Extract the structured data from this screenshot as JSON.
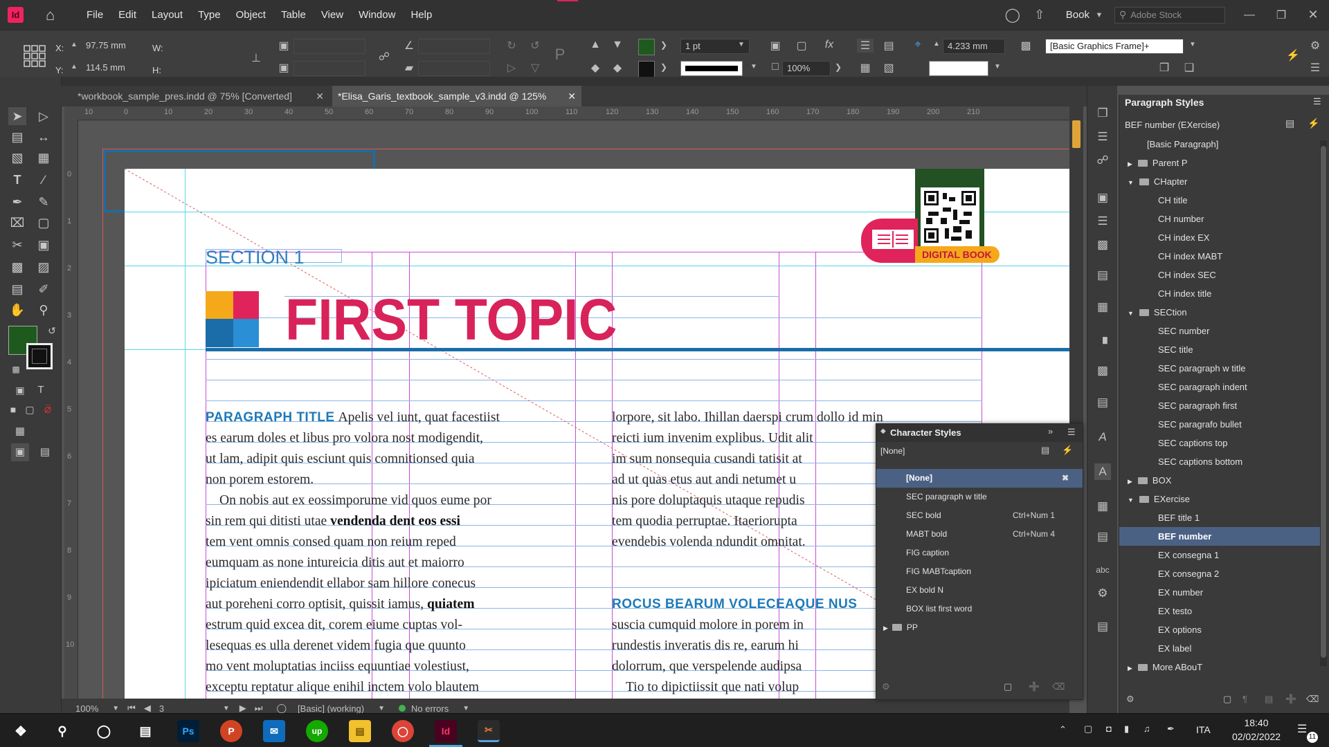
{
  "app": {
    "logo_text": "Id",
    "menu": [
      "File",
      "Edit",
      "Layout",
      "Type",
      "Object",
      "Table",
      "View",
      "Window",
      "Help"
    ],
    "workspace": "Book",
    "stock_placeholder": "Adobe Stock"
  },
  "control": {
    "x_label": "X:",
    "x_value": "97.75 mm",
    "y_label": "Y:",
    "y_value": "114.5 mm",
    "w_label": "W:",
    "h_label": "H:",
    "stroke_weight": "1 pt",
    "opacity": "100%",
    "offset": "4.233 mm",
    "object_style": "[Basic Graphics Frame]+"
  },
  "tabs": [
    {
      "label": "*workbook_sample_pres.indd @ 75% [Converted]"
    },
    {
      "label": "*Elisa_Garis_textbook_sample_v3.indd @ 125%"
    }
  ],
  "ruler_h": [
    "10",
    "0",
    "10",
    "20",
    "30",
    "40",
    "50",
    "60",
    "70",
    "80",
    "90",
    "100",
    "110",
    "120",
    "130",
    "140",
    "150",
    "160",
    "170",
    "180",
    "190",
    "200",
    "210"
  ],
  "ruler_v": [
    "0",
    "1",
    "2",
    "3",
    "4",
    "5",
    "6",
    "7",
    "8",
    "9",
    "10"
  ],
  "document": {
    "section": "SECTION 1",
    "topic": "FIRST TOPIC",
    "digital_book": "DIGITAL BOOK",
    "para_title": "PARAGRAPH TITLE",
    "col1": [
      "Apelis vel iunt, quat facestiist",
      "es earum doles et libus pro volora nost modigendit,",
      "ut lam, adipit quis esciunt quis comnitionsed quia",
      "non porem estorem.",
      "On nobis aut ex eossimporume vid quos eume por",
      "sin rem qui ditisti utae",
      "vendenda dent eos essi",
      "tem vent omnis consed quam non reium reped",
      "eumquam as none intureicia ditis aut et maiorro",
      "ipiciatum eniendendit ellabor sam hillore conecus",
      "aut poreheni corro optisit, quissit iamus,",
      "quiatem",
      "estrum quid excea dit, corem eiume cuptas vol-",
      "lesequas es ulla derenet videm fugia que quunto",
      "mo vent moluptatias inciiss equuntiae volestiust,",
      "exceptu reptatur alique enihil inctem volo blautem"
    ],
    "col2": [
      "lorpore, sit labo. Ihillan daerspi crum dollo id min",
      "reicti ium invenim explibus. Udit alit",
      "im sum nonsequia cusandi tatisit at",
      "ad ut quas etus aut andi netumet u",
      "nis pore doluptaquis utaque repudis",
      "tem quodia perruptae. Itaeriorupta",
      "evendebis volenda ndundit omnitat."
    ],
    "col2_title": "ROCUS BEARUM VOLECEAQUE NUS",
    "col2b": [
      "suscia cumquid molore in porem in",
      "rundestis inveratis dis re, earum hi",
      "dolorrum, que verspelende audipsa",
      "Tio to dipictiissit que nati volup"
    ]
  },
  "status": {
    "zoom": "100%",
    "page": "3",
    "preflight_profile": "[Basic] (working)",
    "errors": "No errors"
  },
  "paragraph_styles": {
    "title": "Paragraph Styles",
    "current": "BEF number (EXercise)",
    "items": [
      {
        "label": "[Basic Paragraph]",
        "level": 1,
        "folder": false
      },
      {
        "label": "Parent P",
        "level": 0,
        "folder": true,
        "open": false
      },
      {
        "label": "CHapter",
        "level": 0,
        "folder": true,
        "open": true
      },
      {
        "label": "CH title",
        "level": 2,
        "folder": false
      },
      {
        "label": "CH number",
        "level": 2,
        "folder": false
      },
      {
        "label": "CH index EX",
        "level": 2,
        "folder": false
      },
      {
        "label": "CH index MABT",
        "level": 2,
        "folder": false
      },
      {
        "label": "CH index SEC",
        "level": 2,
        "folder": false
      },
      {
        "label": "CH index title",
        "level": 2,
        "folder": false
      },
      {
        "label": "SECtion",
        "level": 0,
        "folder": true,
        "open": true
      },
      {
        "label": "SEC number",
        "level": 2,
        "folder": false
      },
      {
        "label": "SEC title",
        "level": 2,
        "folder": false
      },
      {
        "label": "SEC paragraph w title",
        "level": 2,
        "folder": false
      },
      {
        "label": "SEC paragraph indent",
        "level": 2,
        "folder": false
      },
      {
        "label": "SEC paragraph first",
        "level": 2,
        "folder": false
      },
      {
        "label": "SEC paragrafo bullet",
        "level": 2,
        "folder": false
      },
      {
        "label": "SEC captions top",
        "level": 2,
        "folder": false
      },
      {
        "label": "SEC captions bottom",
        "level": 2,
        "folder": false
      },
      {
        "label": "BOX",
        "level": 0,
        "folder": true,
        "open": false
      },
      {
        "label": "EXercise",
        "level": 0,
        "folder": true,
        "open": true
      },
      {
        "label": "BEF title 1",
        "level": 2,
        "folder": false
      },
      {
        "label": "BEF number",
        "level": 2,
        "folder": false,
        "selected": true
      },
      {
        "label": "EX consegna 1",
        "level": 2,
        "folder": false
      },
      {
        "label": "EX consegna 2",
        "level": 2,
        "folder": false
      },
      {
        "label": "EX number",
        "level": 2,
        "folder": false
      },
      {
        "label": "EX testo",
        "level": 2,
        "folder": false
      },
      {
        "label": "EX options",
        "level": 2,
        "folder": false
      },
      {
        "label": "EX label",
        "level": 2,
        "folder": false
      },
      {
        "label": "More ABouT",
        "level": 0,
        "folder": true,
        "open": false
      }
    ]
  },
  "character_styles": {
    "title": "Character Styles",
    "current": "[None]",
    "items": [
      {
        "label": "[None]",
        "shortcut": "",
        "selected": true
      },
      {
        "label": "SEC paragraph w title",
        "shortcut": ""
      },
      {
        "label": "SEC bold",
        "shortcut": "Ctrl+Num 1"
      },
      {
        "label": "MABT bold",
        "shortcut": "Ctrl+Num 4"
      },
      {
        "label": "FIG caption",
        "shortcut": ""
      },
      {
        "label": "FIG MABTcaption",
        "shortcut": ""
      },
      {
        "label": "EX bold N",
        "shortcut": ""
      },
      {
        "label": "BOX list first word",
        "shortcut": ""
      }
    ],
    "folder": "PP"
  },
  "taskbar": {
    "lang": "ITA",
    "time": "18:40",
    "date": "02/02/2022",
    "notif": "11"
  },
  "colors": {
    "accent_red": "#e0235b",
    "accent_blue": "#1a6da8",
    "guide_cyan": "#55d8e8",
    "margin_magenta": "#c84bd8",
    "fill_swatch": "#1e5a1e",
    "select_blue": "#4b6184"
  }
}
